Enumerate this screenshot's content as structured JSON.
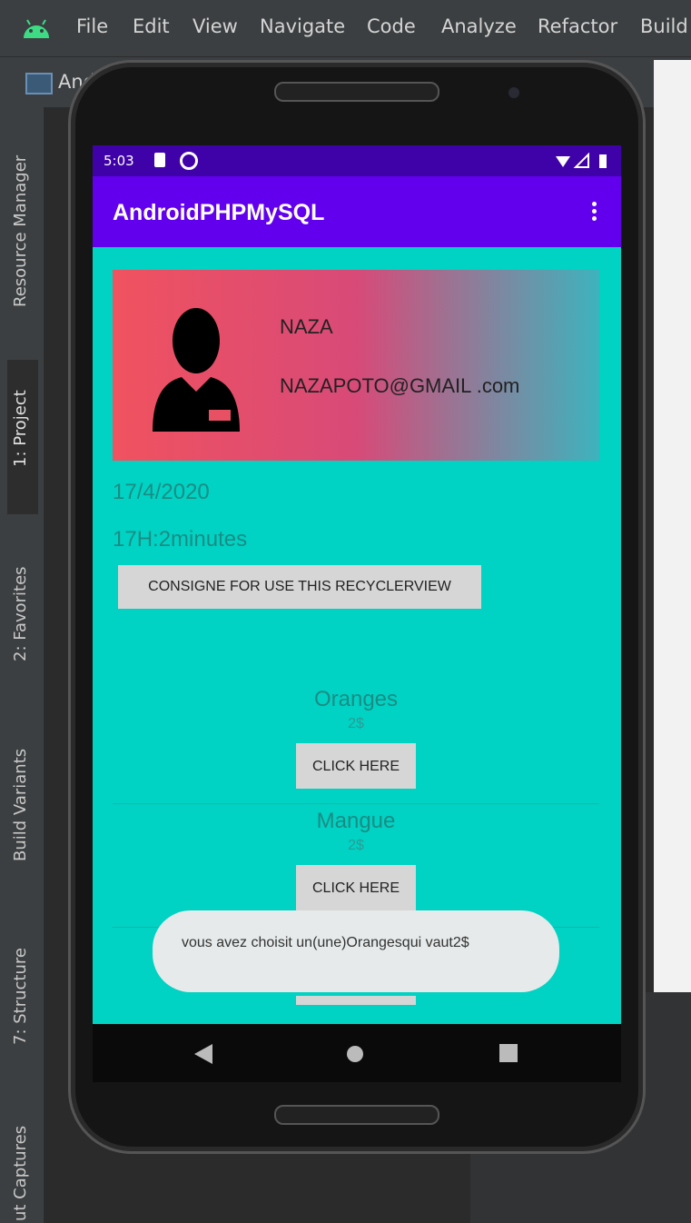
{
  "ide": {
    "menu": [
      "File",
      "Edit",
      "View",
      "Navigate",
      "Code",
      "Analyze",
      "Refactor",
      "Build"
    ],
    "menu_mnemonics": [
      "F",
      "E",
      "V",
      "N",
      "C",
      "z",
      "R",
      "B"
    ],
    "window_title_partial": "And",
    "side_tabs": [
      "Resource Manager",
      "1: Project",
      "2: Favorites",
      "Build Variants",
      "7: Structure",
      "ut Captures"
    ]
  },
  "phone": {
    "status": {
      "time": "5:03"
    },
    "app_title": "AndroidPHPMySQL",
    "profile": {
      "name": "NAZA",
      "email": "NAZAPOTO@GMAIL .com"
    },
    "date": "17/4/2020",
    "time": "17H:2minutes",
    "consigne_label": "CONSIGNE FOR USE THIS RECYCLERVIEW",
    "items": [
      {
        "name": "Oranges",
        "price": "2$",
        "button": "CLICK HERE"
      },
      {
        "name": "Mangue",
        "price": "2$",
        "button": "CLICK HERE"
      }
    ],
    "toast": "vous avez choisit un(une)Orangesqui vaut2$"
  },
  "colors": {
    "app_bar": "#6200ee",
    "status_bar": "#3f01a8",
    "background": "#00d2c3",
    "text_teal": "#1b8c84"
  }
}
